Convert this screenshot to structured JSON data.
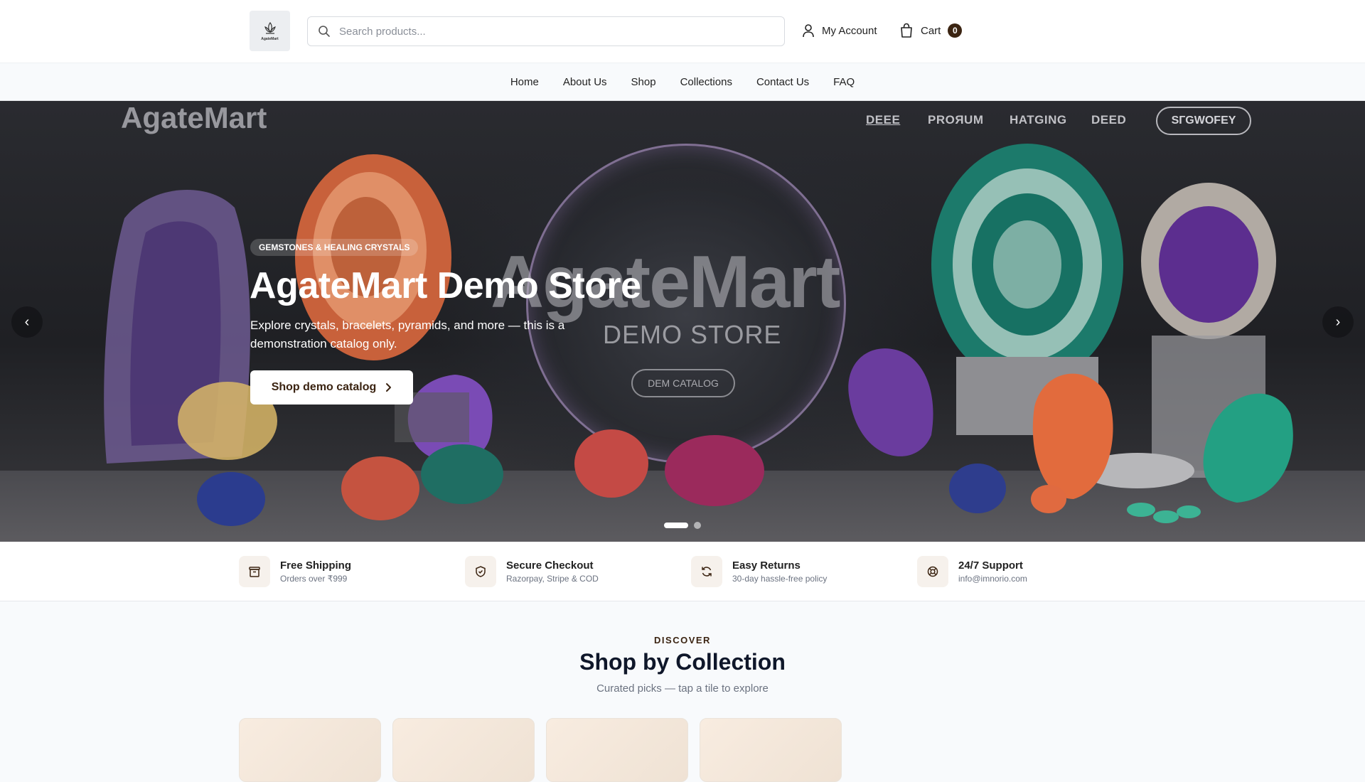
{
  "header": {
    "logo_text": "AgateMart",
    "search_placeholder": "Search products...",
    "account_label": "My Account",
    "cart_label": "Cart",
    "cart_count": "0"
  },
  "nav": {
    "items": [
      "Home",
      "About Us",
      "Shop",
      "Collections",
      "Contact Us",
      "FAQ"
    ]
  },
  "hero": {
    "bg_brand": "AgateMart",
    "bg_nav": [
      "DEEE",
      "PROЯUM",
      "HATGING",
      "DEED"
    ],
    "bg_pill": "SГGWOFEY",
    "bg_big": "AgateMart",
    "bg_demo": "DEMO STORE",
    "bg_catalog": "DEM CATALOG",
    "badge": "GEMSTONES & HEALING CRYSTALS",
    "title": "AgateMart Demo Store",
    "subtitle": "Explore crystals, bracelets, pyramids, and more — this is a demonstration catalog only.",
    "cta_label": "Shop demo catalog",
    "prev_label": "‹",
    "next_label": "›",
    "slide_count": 2,
    "active_slide": 1
  },
  "features": [
    {
      "title": "Free Shipping",
      "subtitle": "Orders over ₹999",
      "icon": "package-icon"
    },
    {
      "title": "Secure Checkout",
      "subtitle": "Razorpay, Stripe & COD",
      "icon": "shield-check-icon"
    },
    {
      "title": "Easy Returns",
      "subtitle": "30-day hassle-free policy",
      "icon": "refresh-icon"
    },
    {
      "title": "24/7 Support",
      "subtitle": "info@imnorio.com",
      "icon": "lifebuoy-icon"
    }
  ],
  "collections": {
    "eyebrow": "DISCOVER",
    "title": "Shop by Collection",
    "subtitle": "Curated picks — tap a tile to explore",
    "tile_count": 4
  },
  "colors": {
    "brand_dark": "#3b2412",
    "feature_icon_bg": "#f6f1ec"
  }
}
